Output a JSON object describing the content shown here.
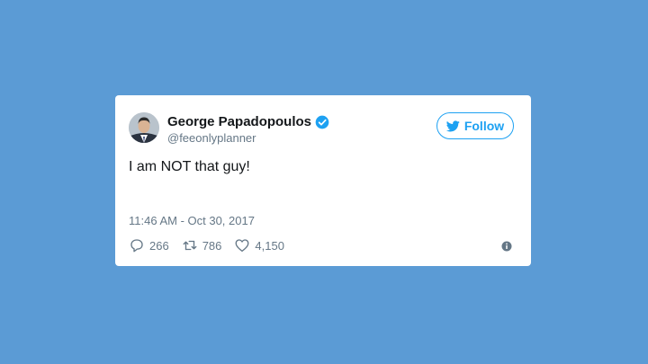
{
  "tweet": {
    "display_name": "George Papadopoulos",
    "handle": "@feeonlyplanner",
    "verified": true,
    "text": "I am NOT that guy!",
    "timestamp": "11:46 AM - Oct 30, 2017",
    "follow_label": "Follow",
    "stats": {
      "replies": "266",
      "retweets": "786",
      "likes": "4,150"
    }
  },
  "icons": {
    "avatar": "avatar",
    "verified": "verified-badge-icon",
    "follow": "twitter-bird-icon",
    "reply": "reply-icon",
    "retweet": "retweet-icon",
    "like": "heart-icon",
    "info": "info-icon"
  },
  "colors": {
    "background": "#5b9bd5",
    "accent": "#1da1f2",
    "text_primary": "#14171a",
    "text_secondary": "#657786"
  }
}
